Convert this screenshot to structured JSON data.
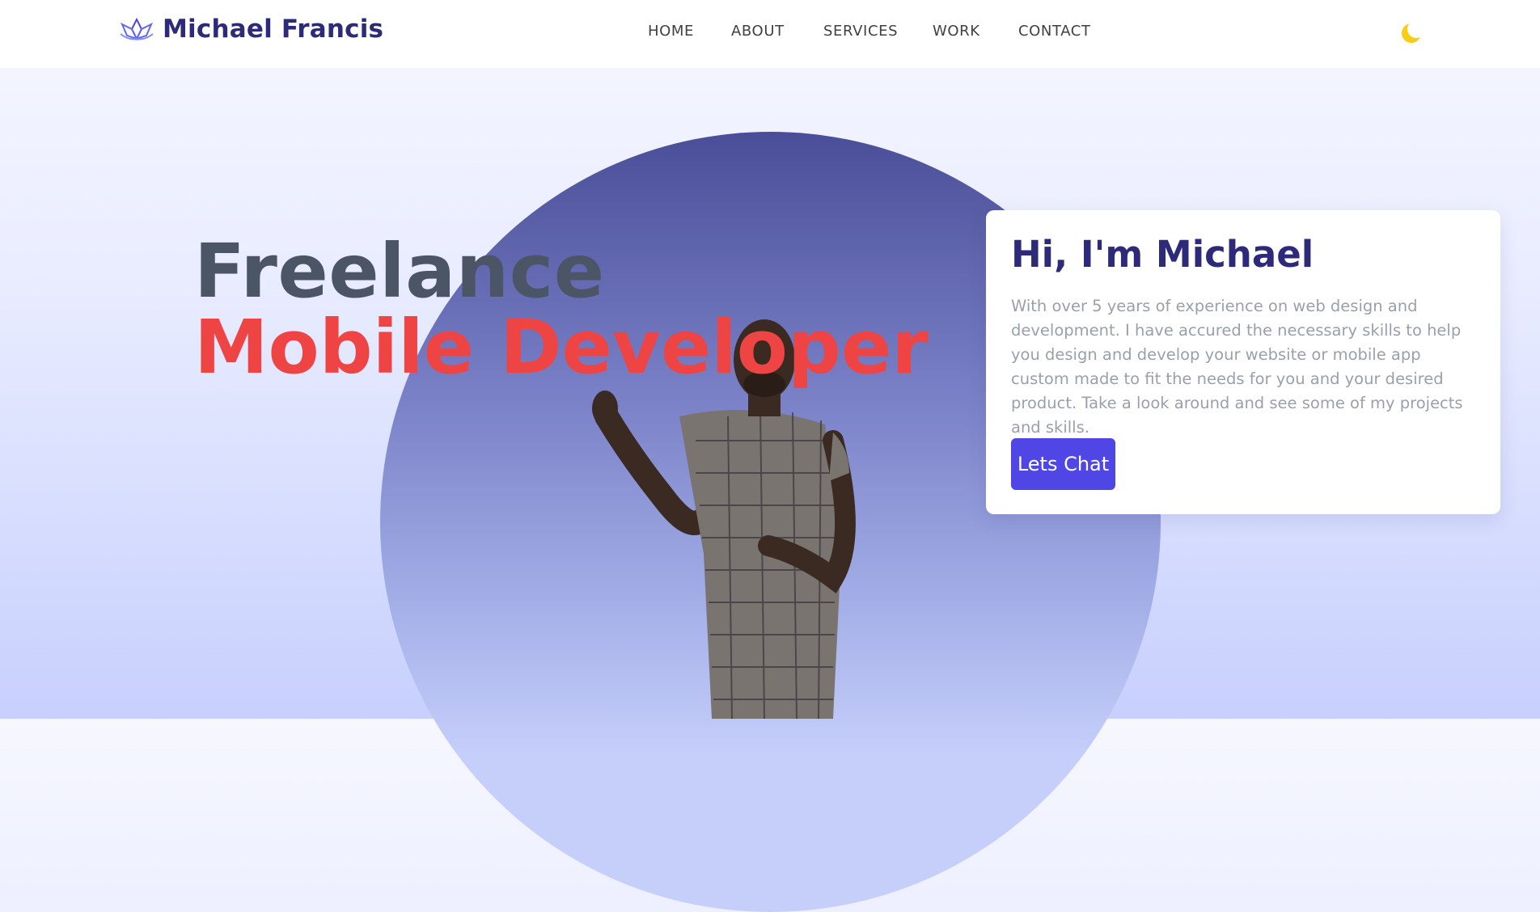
{
  "nav": {
    "brand_name": "Michael Francis",
    "items": [
      {
        "label": "HOME"
      },
      {
        "label": "ABOUT"
      },
      {
        "label": "SERVICES"
      },
      {
        "label": "WORK"
      },
      {
        "label": "CONTACT"
      }
    ],
    "theme_icon": "moon-icon"
  },
  "hero": {
    "line1": "Freelance",
    "line2": "Mobile Developer"
  },
  "card": {
    "title": "Hi, I'm Michael",
    "body": "With over 5 years of experience on web design and development. I have accured the necessary skills to help you design and develop your website or mobile app custom made to fit the needs for you and your desired product. Take a look around and see some of my projects and skills.",
    "cta_label": "Lets Chat"
  },
  "colors": {
    "brand": "#2e2a7a",
    "accent": "#ef4444",
    "button": "#4f46e5",
    "moon": "#facc15"
  }
}
